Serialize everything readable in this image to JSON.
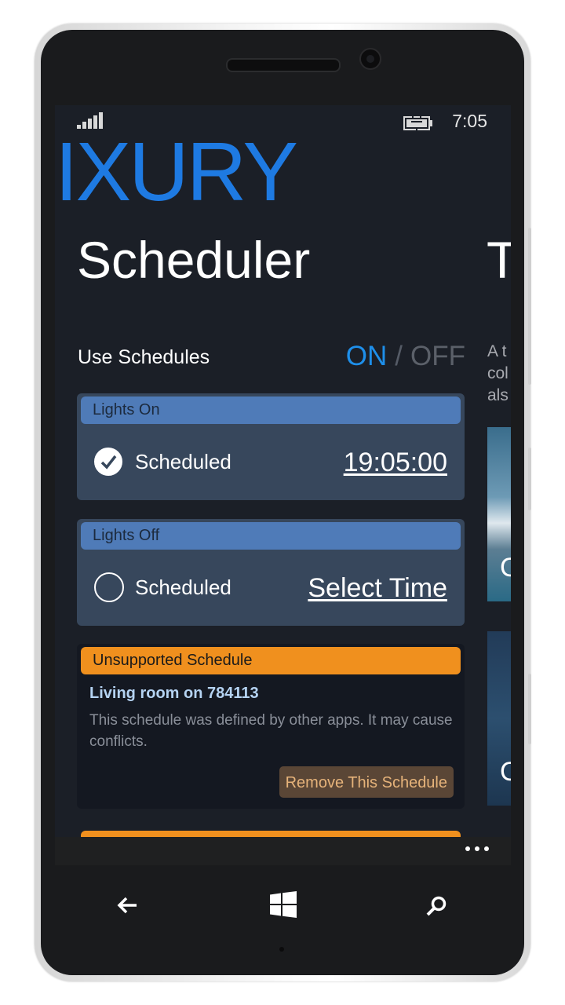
{
  "status_bar": {
    "clock": "7:05",
    "signal_icon": "signal-strength-icon",
    "battery_icon": "battery-charging-icon"
  },
  "app": {
    "title": "IXURY",
    "page_title": "Scheduler",
    "next_page_title": "T",
    "next_page_desc": [
      "A t",
      "col",
      "als"
    ],
    "next_page_img_texts": [
      "C",
      "C"
    ]
  },
  "use_schedules": {
    "label": "Use Schedules",
    "on_label": "ON",
    "separator": "/",
    "off_label": "OFF",
    "state": "ON"
  },
  "schedules": [
    {
      "header": "Lights On",
      "checked": true,
      "label": "Scheduled",
      "time": "19:05:00"
    },
    {
      "header": "Lights Off",
      "checked": false,
      "label": "Scheduled",
      "time": "Select Time"
    }
  ],
  "unsupported": {
    "header": "Unsupported Schedule",
    "name": "Living room on 784113",
    "description": "This schedule was defined by other apps. It may cause conflicts.",
    "remove_label": "Remove This Schedule"
  },
  "app_bar": {
    "more_icon": "ellipsis-icon"
  },
  "hardware_buttons": {
    "back_icon": "back-arrow-icon",
    "start_icon": "windows-logo-icon",
    "search_icon": "search-icon"
  },
  "colors": {
    "accent": "#1e7ae2",
    "card_header": "#4f7bb8",
    "warning": "#f0901e"
  }
}
